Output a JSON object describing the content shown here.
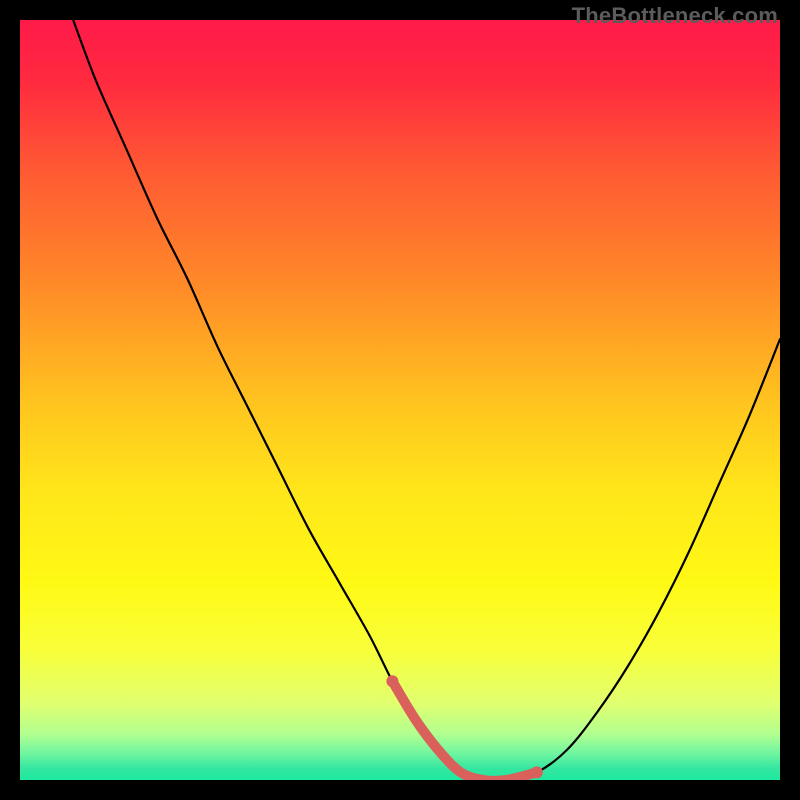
{
  "watermark": {
    "text": "TheBottleneck.com"
  },
  "gradient": {
    "stops": [
      {
        "offset": 0.0,
        "color": "#ff1a4a"
      },
      {
        "offset": 0.08,
        "color": "#ff2a3f"
      },
      {
        "offset": 0.2,
        "color": "#ff5a33"
      },
      {
        "offset": 0.35,
        "color": "#ff8a28"
      },
      {
        "offset": 0.5,
        "color": "#ffc31f"
      },
      {
        "offset": 0.62,
        "color": "#ffe61a"
      },
      {
        "offset": 0.74,
        "color": "#fff915"
      },
      {
        "offset": 0.83,
        "color": "#f8ff3a"
      },
      {
        "offset": 0.9,
        "color": "#e0ff70"
      },
      {
        "offset": 0.94,
        "color": "#b0ff90"
      },
      {
        "offset": 0.965,
        "color": "#70f5a0"
      },
      {
        "offset": 0.985,
        "color": "#33e6a0"
      },
      {
        "offset": 1.0,
        "color": "#1de9a0"
      }
    ]
  },
  "highlight": {
    "color": "#d9605b",
    "stroke_width": 10
  },
  "chart_data": {
    "type": "line",
    "title": "",
    "xlabel": "",
    "ylabel": "",
    "xlim": [
      0,
      100
    ],
    "ylim": [
      0,
      100
    ],
    "series": [
      {
        "name": "bottleneck-curve",
        "x": [
          7,
          10,
          14,
          18,
          22,
          26,
          30,
          34,
          38,
          42,
          46,
          49,
          52,
          55,
          58,
          61,
          64,
          68,
          72,
          76,
          80,
          84,
          88,
          92,
          96,
          100
        ],
        "values": [
          100,
          92,
          83,
          74,
          66,
          57,
          49,
          41,
          33,
          26,
          19,
          13,
          8,
          4,
          1,
          0,
          0,
          1,
          4,
          9,
          15,
          22,
          30,
          39,
          48,
          58
        ]
      },
      {
        "name": "highlight-segment",
        "x": [
          49,
          52,
          55,
          58,
          61,
          64,
          68
        ],
        "values": [
          13,
          8,
          4,
          1,
          0,
          0,
          1
        ]
      }
    ],
    "annotations": [
      {
        "type": "watermark",
        "text": "TheBottleneck.com",
        "pos": "top-right"
      }
    ]
  }
}
